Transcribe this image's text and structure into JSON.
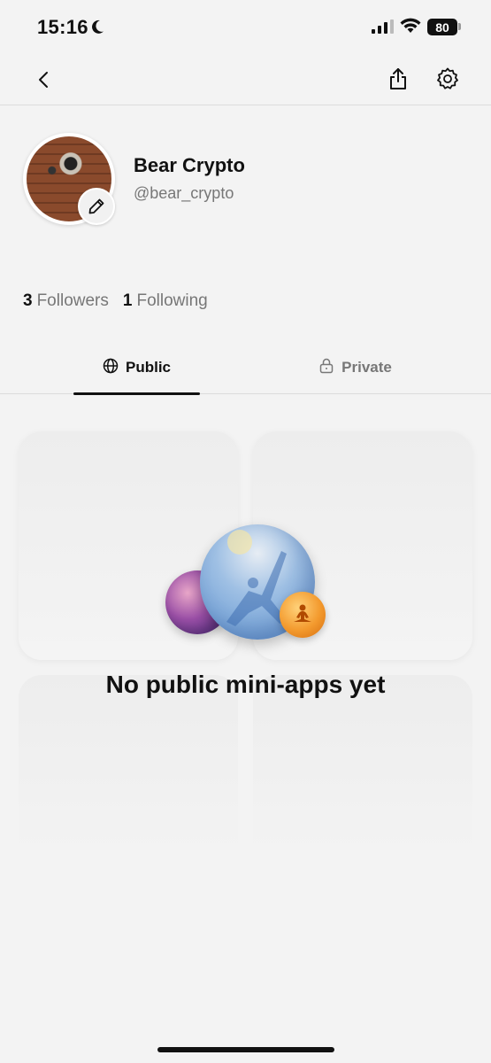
{
  "status_bar": {
    "time": "15:16",
    "battery": "80",
    "icons": [
      "moon-icon",
      "signal-icon",
      "wifi-icon",
      "battery-icon"
    ]
  },
  "header": {
    "icons": [
      "back-chevron-icon",
      "share-icon",
      "gear-icon"
    ]
  },
  "profile": {
    "display_name": "Bear Crypto",
    "username": "@bear_crypto",
    "followers_count": "3",
    "followers_label": "Followers",
    "following_count": "1",
    "following_label": "Following"
  },
  "tabs": [
    {
      "label": "Public",
      "icon": "globe-icon",
      "selected": true
    },
    {
      "label": "Private",
      "icon": "lock-icon",
      "selected": false
    }
  ],
  "empty_state": {
    "title": "No public mini-apps yet"
  },
  "colors": {
    "background": "#f3f3f3",
    "text_primary": "#111111",
    "text_secondary": "#777777",
    "divider": "#dcdcdc"
  }
}
